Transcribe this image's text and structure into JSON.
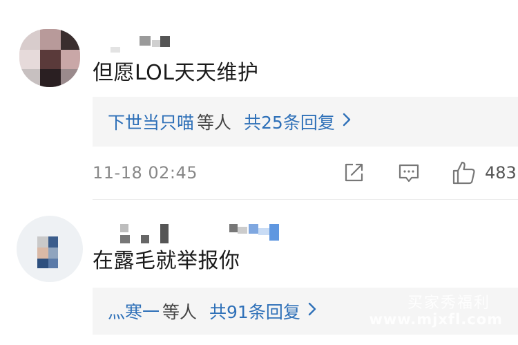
{
  "comments": [
    {
      "text": "但愿LOL天天维护",
      "reply_names": "下世当只喵",
      "reply_others": "等人",
      "reply_total": "共25条回复",
      "time": "11-18 02:45",
      "likes": "483"
    },
    {
      "text": "在露毛就举报你",
      "reply_names": "灬寒一",
      "reply_others": "等人",
      "reply_total": "共91条回复"
    }
  ],
  "watermark": {
    "line1": "买家秀福利",
    "line2": "www.mjxfl.com"
  },
  "icons": {
    "share": "share-icon",
    "comment": "comment-icon",
    "like": "thumbs-up-icon",
    "chevron": "chevron-right-icon"
  },
  "colors": {
    "link_blue": "#2e70b8",
    "reply_bg": "#f5f5f5",
    "meta_gray": "#888888"
  }
}
